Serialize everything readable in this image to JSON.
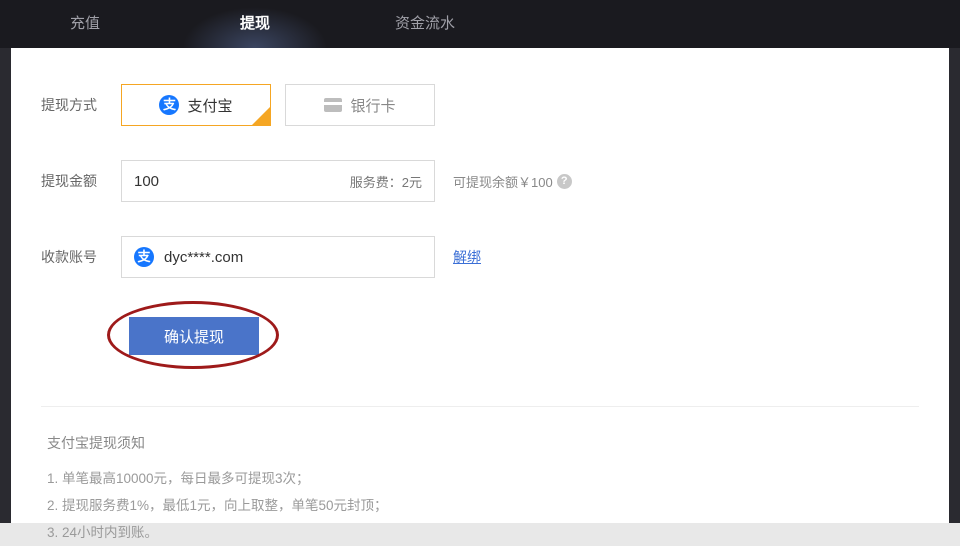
{
  "tabs": {
    "recharge": "充值",
    "withdraw": "提现",
    "flow": "资金流水"
  },
  "labels": {
    "method": "提现方式",
    "amount": "提现金额",
    "account": "收款账号"
  },
  "methods": {
    "alipay_badge": "支",
    "alipay": "支付宝",
    "bank": "银行卡"
  },
  "amount": {
    "value": "100",
    "fee": "服务费：2元"
  },
  "balance": {
    "text": "可提现余额￥100",
    "help": "?"
  },
  "account": {
    "badge": "支",
    "value": "dyc****.com",
    "unbind": "解绑"
  },
  "submit": {
    "label": "确认提现"
  },
  "notice": {
    "title": "支付宝提现须知",
    "line1": "1. 单笔最高10000元，每日最多可提现3次；",
    "line2": "2. 提现服务费1%，最低1元，向上取整，单笔50元封顶；",
    "line3": "3. 24小时内到账。"
  }
}
